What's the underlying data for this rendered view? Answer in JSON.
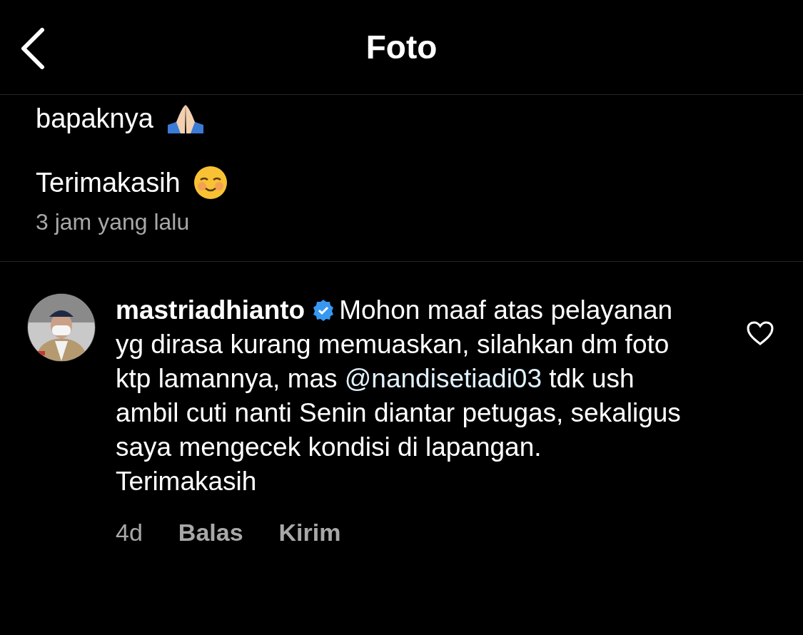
{
  "header": {
    "title": "Foto"
  },
  "previous_comment": {
    "lines": [
      "bapaknya",
      "Terimakasih"
    ],
    "time": "3 jam yang lalu"
  },
  "comment": {
    "username": "mastriadhianto",
    "verified": true,
    "text_before": "Mohon maaf atas pelayanan yg dirasa kurang memuaskan, silahkan dm foto ktp lamannya, mas",
    "mention": "@nandisetiadi03",
    "text_after": "tdk ush ambil cuti nanti Senin diantar petugas, sekaligus saya mengecek kondisi di lapangan.\nTerimakasih",
    "liked": false,
    "age": "4d",
    "actions": [
      "Balas",
      "Kirim"
    ]
  }
}
